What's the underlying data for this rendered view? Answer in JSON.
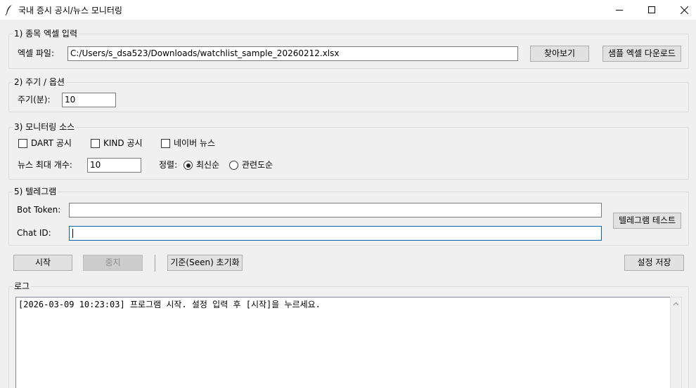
{
  "window": {
    "title": "국내 증시 공시/뉴스 모니터링",
    "icon": "feather-icon"
  },
  "section_excel": {
    "legend": "1) 종목 엑셀 입력",
    "file_label": "엑셀 파일:",
    "file_value": "C:/Users/s_dsa523/Downloads/watchlist_sample_20260212.xlsx",
    "browse_button": "찾아보기",
    "sample_button": "샘플 엑셀 다운로드"
  },
  "section_options": {
    "legend": "2) 주기 / 옵션",
    "period_label": "주기(분):",
    "period_value": "10"
  },
  "section_sources": {
    "legend": "3) 모니터링 소스",
    "dart_label": "DART 공시",
    "dart_checked": false,
    "kind_label": "KIND 공시",
    "kind_checked": false,
    "naver_label": "네이버 뉴스",
    "naver_checked": false,
    "max_news_label": "뉴스 최대 개수:",
    "max_news_value": "10",
    "sort_label": "정렬:",
    "sort_latest": "최신순",
    "sort_relevance": "관련도순",
    "sort_selected": "최신순"
  },
  "section_telegram": {
    "legend": "5) 텔레그램",
    "token_label": "Bot Token:",
    "token_value": "",
    "chat_label": "Chat ID:",
    "chat_value": "",
    "test_button": "텔레그램 테스트"
  },
  "toolbar": {
    "start": "시작",
    "stop": "중지",
    "reset_seen": "기준(Seen) 초기화",
    "save_settings": "설정 저장"
  },
  "log": {
    "label": "로그",
    "lines": [
      "[2026-03-09 10:23:03] 프로그램 시작. 설정 입력 후 [시작]을 누르세요."
    ]
  }
}
